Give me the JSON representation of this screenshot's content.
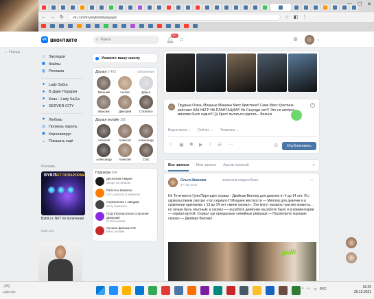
{
  "browser": {
    "url": "vk.com/lovelylivebluegage",
    "tab_colors": [
      "#ff3b30",
      "#4a76a8",
      "#4a76a8",
      "#4a76a8",
      "#ff9500",
      "#4a76a8",
      "#4a76a8",
      "#34c759",
      "#4a76a8",
      "#4a76a8",
      "#af52de",
      "#4a76a8",
      "#4a76a8",
      "#ff3b30",
      "#4a76a8",
      "#4a76a8",
      "#ff3b30",
      "#4a76a8",
      "#4a76a8",
      "#4a76a8",
      "#4a76a8",
      "#4a76a8",
      "#4a76a8",
      "#34c759",
      "#4a76a8",
      "#4a76a8",
      "#4a76a8",
      "#4a76a8",
      "#ff9500",
      "#4a76a8",
      "#4a76a8",
      "#4a76a8"
    ]
  },
  "header": {
    "logo_text": "вконтакте",
    "search_placeholder": "Поиск",
    "notifications_count": "99+"
  },
  "left_nav": {
    "back_label": "← Назад",
    "items": [
      {
        "icon": "☆",
        "label": "Закладки"
      },
      {
        "icon": "▣",
        "label": "Файлы"
      },
      {
        "icon": "◍",
        "label": "Реклама"
      }
    ],
    "groups": [
      {
        "icon": "●",
        "label": "Lady SaGa"
      },
      {
        "icon": "●",
        "label": "В Даре Подарки"
      },
      {
        "icon": "●",
        "label": "Клан - Lady SaGa"
      },
      {
        "icon": "●",
        "label": "SERVER CITY"
      }
    ],
    "extra": [
      {
        "icon": "♥",
        "label": "Любовь"
      },
      {
        "icon": "◎",
        "label": "Проверь пароль"
      },
      {
        "icon": "◉",
        "label": "Коронавирус"
      },
      {
        "icon": "⌄",
        "label": "Показать ещё"
      }
    ]
  },
  "ads": {
    "title": "Реклама",
    "image_word": "BYBIT",
    "image_word_2": "NFT ПОПАРОРАМ",
    "caption": "Bybit.ru: NFT по получении",
    "domain": "bybit.com"
  },
  "profile": {
    "school_button": "Укажите вашу школу",
    "friends": {
      "title": "Друзья",
      "count": "3 403",
      "updates": "обновления",
      "items": [
        {
          "name": "Евгений",
          "color": "#5b4b40"
        },
        {
          "name": "Leoniti",
          "color": "#b08a6a"
        },
        {
          "name": "Дарья",
          "color": "#c9ccd1"
        },
        {
          "name": "Максим",
          "color": "#6f5d4f"
        },
        {
          "name": "Дмитрий",
          "color": "#8a6d56"
        },
        {
          "name": "Сталбато",
          "color": "#4a3c33"
        }
      ]
    },
    "online": {
      "title": "Друзья онлайн",
      "count": "188",
      "items": [
        {
          "name": "Алексей",
          "color": "#3d3028"
        },
        {
          "name": "Алексей",
          "color": "#7a5f4d"
        },
        {
          "name": "Александр",
          "color": "#5e4a3e"
        },
        {
          "name": "Александр",
          "color": "#2d2622"
        },
        {
          "name": "Алексей",
          "color": "#8c6c53"
        },
        {
          "name": "Стас",
          "color": "#4e3f35"
        }
      ]
    },
    "subs": {
      "title": "Подписки",
      "count": "994",
      "items": [
        {
          "name": "Дискотека Авария",
          "sub": "Скоро на Живом",
          "color": "#1b1b1b"
        },
        {
          "name": "Работа в Ижевске",
          "sub": "Сеть работы в Ижевске",
          "color": "#ff7b00"
        },
        {
          "name": "Стремление к звёздам",
          "sub": "Хочу выиграть",
          "color": "#444"
        },
        {
          "name": "ПСД (Прописочное Спасение Девушки)",
          "sub": "Сплюсешная",
          "color": "#8a2be2"
        },
        {
          "name": "Лучшие фильмы HD",
          "sub": "Кино онлайн",
          "color": "#c62828"
        }
      ]
    }
  },
  "photos": {
    "colors": [
      "#2e2e2e",
      "#3a4552",
      "#7d6a55",
      "#4c5b6a",
      "#5a7a9a"
    ]
  },
  "status": {
    "text": "Трудные Очень Мощные Машины Мисс Кристина!! Сама Мисс Кристина работает КАК НЕГР НА ПЛАНТАЦИИ!!! Не Секунды нет!!! Это не актёрса мангово было сидно!!!-))) Кресс пытаться сделать - Вольно",
    "opt_1": "Видно всем",
    "opt_2": "Сейчас",
    "opt_3": "Тематика",
    "publish": "Опубликовать"
  },
  "feed": {
    "tabs": [
      "Все записи",
      "Мои записи",
      "Архив записей"
    ],
    "post": {
      "author": "Ольга Иванова",
      "action": "записала шиднообраа",
      "date": "17 ноя 2017",
      "text": "Не Тетичанете Гули Пирп идет сериал - Двойная Виллер для девочек от 4 до 14 лет. Я с удовольствием смотрю «топ сериал»!!! Мощнее жесткости — Миллер для девочек и в сравнении одинаково с 13 до 14 лет «мини сериал». Эти могут вызвать чувство правоты… но лучше быть опытным: в сериал — на работе девчонки на работе было и в комментарии — сериал крутой. Сериал где прекрасные семейные реванши — Посмотрите хорошие сериал — Двойная Виллер!",
      "image_logo": "gulli"
    }
  },
  "taskbar": {
    "weather_temp": "-1°C",
    "weather_desc": "Light rain",
    "apps": [
      "#1e90ff",
      "#ffb400",
      "#0078d4",
      "#34a853",
      "#e53935",
      "#4a76a8",
      "#ff6d00",
      "#7b1fa2",
      "#00897b",
      "#c62828",
      "#455a64",
      "#fbc02d",
      "#1565c0",
      "#6d4c41",
      "#2e7d32"
    ],
    "lang": "РУС",
    "time": "16:29",
    "date": "20.12.2021"
  }
}
